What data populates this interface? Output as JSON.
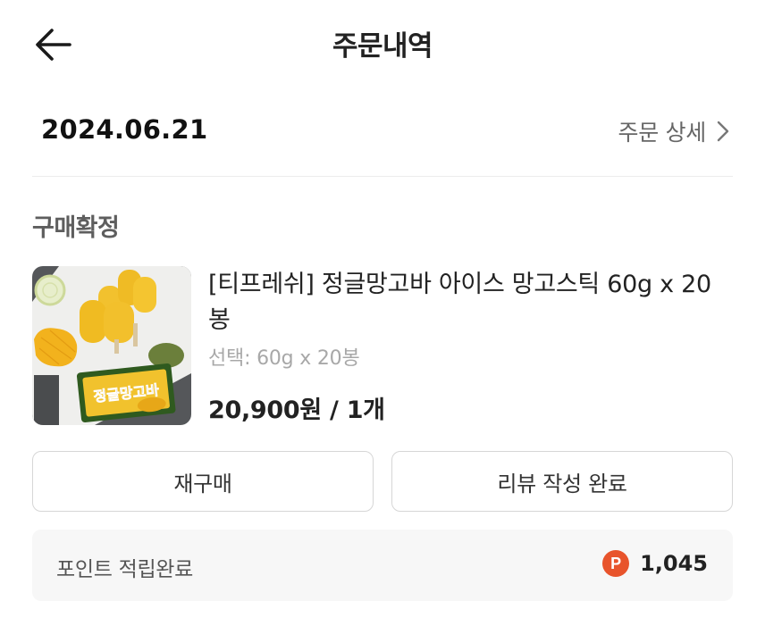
{
  "header": {
    "title": "주문내역",
    "back_icon": "arrow-left-icon"
  },
  "order": {
    "date": "2024.06.21",
    "detail_link": "주문 상세",
    "detail_icon": "chevron-right-icon",
    "status": "구매확정"
  },
  "product": {
    "name": "[티프레쉬] 정글망고바 아이스 망고스틱 60g x 20봉",
    "option": "선택: 60g x 20봉",
    "price": "20,900원 / 1개",
    "package_text": "정글망고바"
  },
  "actions": {
    "rebuy_label": "재구매",
    "review_label": "리뷰 작성 완료"
  },
  "points": {
    "label": "포인트 적립완료",
    "icon_letter": "P",
    "value": "1,045",
    "icon_color": "#e8542c"
  }
}
